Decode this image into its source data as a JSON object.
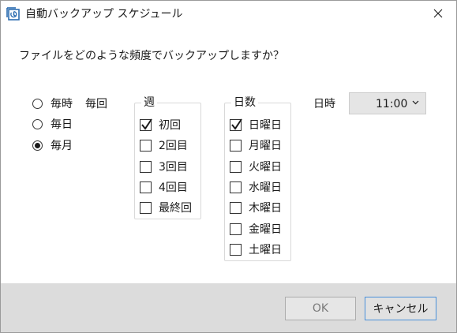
{
  "window": {
    "title": "自動バックアップ スケジュール",
    "app_icon": "backup-schedule-icon",
    "close_icon": "close-icon"
  },
  "question": "ファイルをどのような頻度でバックアップしますか？",
  "frequency": {
    "options": [
      {
        "label": "毎時",
        "extra": "毎回",
        "checked": false
      },
      {
        "label": "毎日",
        "checked": false
      },
      {
        "label": "毎月",
        "checked": true
      }
    ]
  },
  "week_group": {
    "legend": "週",
    "items": [
      {
        "label": "初回",
        "checked": true
      },
      {
        "label": "2回目",
        "checked": false
      },
      {
        "label": "3回目",
        "checked": false
      },
      {
        "label": "4回目",
        "checked": false
      },
      {
        "label": "最終回",
        "checked": false
      }
    ]
  },
  "day_group": {
    "legend": "日数",
    "items": [
      {
        "label": "日曜日",
        "checked": true
      },
      {
        "label": "月曜日",
        "checked": false
      },
      {
        "label": "火曜日",
        "checked": false
      },
      {
        "label": "水曜日",
        "checked": false
      },
      {
        "label": "木曜日",
        "checked": false
      },
      {
        "label": "金曜日",
        "checked": false
      },
      {
        "label": "土曜日",
        "checked": false
      }
    ]
  },
  "time": {
    "label": "日時",
    "value": "11:00"
  },
  "buttons": {
    "ok": "OK",
    "cancel": "キャンセル"
  },
  "colors": {
    "footer_bg": "#dcdcdc",
    "focus_border": "#4a90d9",
    "disabled_text": "#7a7a7a",
    "icon_blue": "#2b6cb0"
  }
}
